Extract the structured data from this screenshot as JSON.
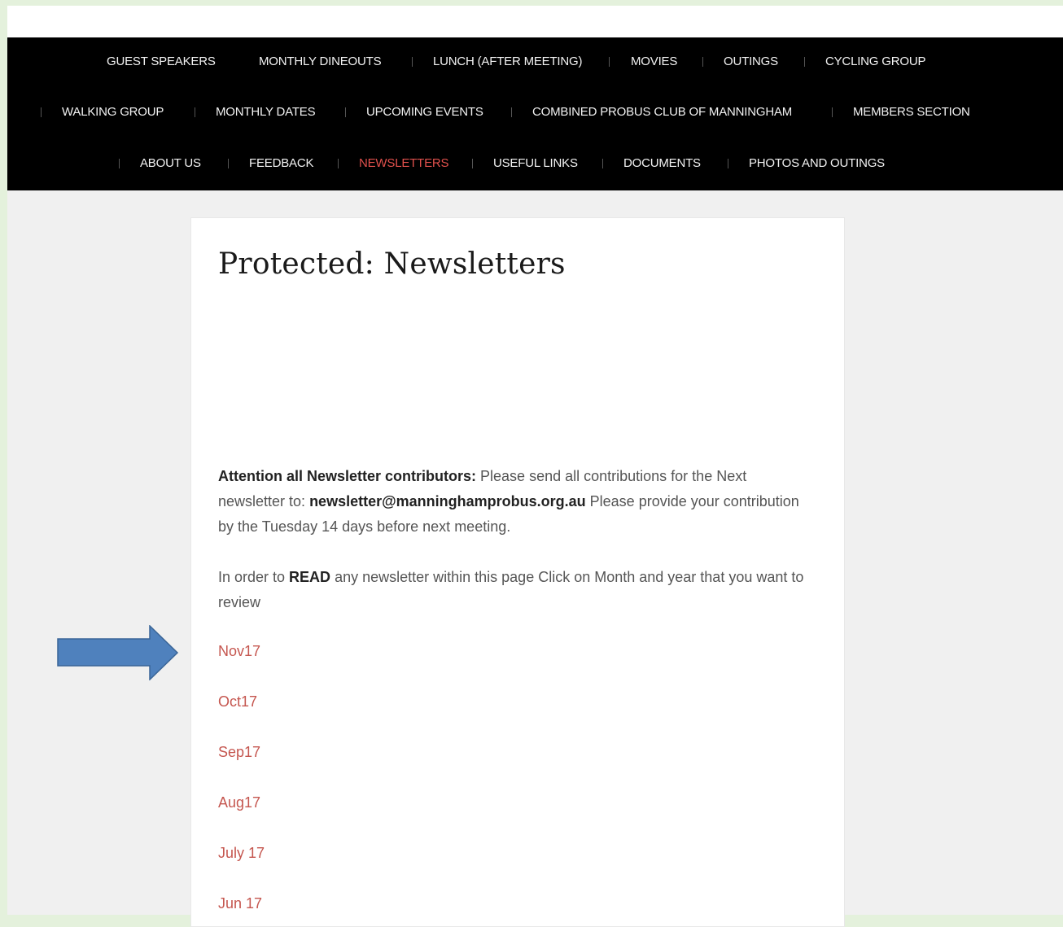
{
  "nav": {
    "row1": [
      "GUEST SPEAKERS",
      "MONTHLY DINEOUTS",
      "LUNCH (AFTER MEETING)",
      "MOVIES",
      "OUTINGS",
      "CYCLING GROUP"
    ],
    "row2": [
      "WALKING GROUP",
      "MONTHLY DATES",
      "UPCOMING EVENTS",
      "COMBINED PROBUS CLUB OF MANNINGHAM",
      "MEMBERS SECTION"
    ],
    "row3": [
      "ABOUT US",
      "FEEDBACK",
      "NEWSLETTERS",
      "USEFUL LINKS",
      "DOCUMENTS",
      "PHOTOS AND OUTINGS"
    ],
    "active": "NEWSLETTERS"
  },
  "page": {
    "title": "Protected: Newsletters",
    "attention_label": "Attention all Newsletter contributors:",
    "attention_text_1": " Please send all contributions for the Next newsletter to: ",
    "email": "newsletter@manninghamprobus.org.au",
    "attention_text_2": "  Please provide your contribution by the Tuesday 14 days before next meeting.",
    "read_prefix": "In order to ",
    "read_bold": "READ",
    "read_suffix": " any newsletter within this page Click on  Month and year that you want to review",
    "newsletters": [
      "Nov17",
      "Oct17",
      "Sep17",
      "Aug17",
      "July 17",
      "Jun 17"
    ]
  },
  "colors": {
    "nav_bg": "#000000",
    "active": "#e0504c",
    "link": "#c5564f",
    "arrow": "#4f81bd"
  }
}
